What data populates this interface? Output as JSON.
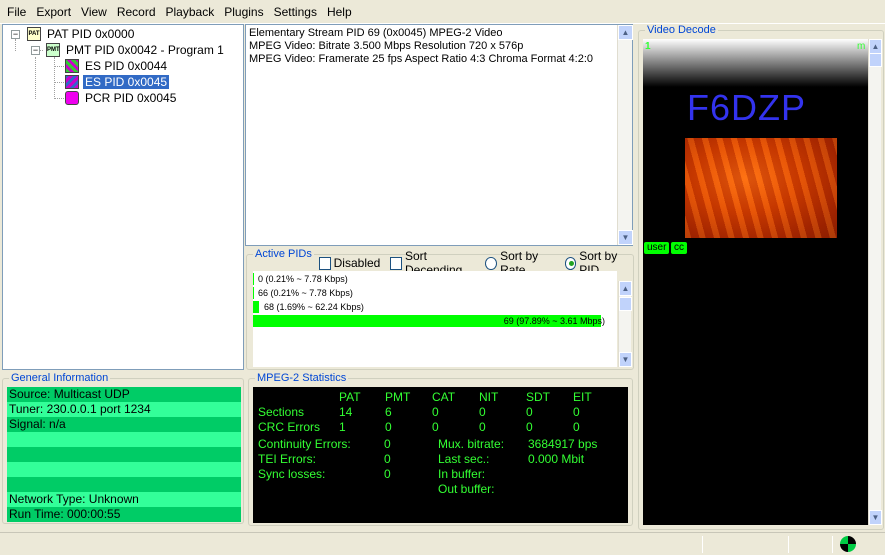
{
  "menu": [
    "File",
    "Export",
    "View",
    "Record",
    "Playback",
    "Plugins",
    "Settings",
    "Help"
  ],
  "tree": {
    "pat": "PAT PID 0x0000",
    "pmt": "PMT PID 0x0042 - Program 1",
    "es_audio": "ES PID 0x0044",
    "es_video": "ES PID 0x0045",
    "pcr": "PCR PID 0x0045"
  },
  "info_lines": [
    "Elementary Stream PID 69 (0x0045) MPEG-2 Video",
    "MPEG Video: Bitrate 3.500 Mbps Resolution 720 x 576p",
    "MPEG Video: Framerate 25 fps Aspect Ratio 4:3 Chroma Format 4:2:0"
  ],
  "active_pids": {
    "title": "Active PIDs",
    "disabled_label": "Disabled",
    "sort_desc_label": "Sort Decending",
    "sort_rate_label": "Sort by Rate",
    "sort_pid_label": "Sort by PID",
    "sort_selected": "Sort by PID",
    "rows": [
      {
        "label": "0 (0.21% ~ 7.78 Kbps)",
        "share": 0.21
      },
      {
        "label": "66 (0.21% ~ 7.78 Kbps)",
        "share": 0.21
      },
      {
        "label": "68 (1.69% ~ 62.24 Kbps)",
        "share": 1.69
      },
      {
        "label": "69 (97.89% ~ 3.61 Mbps)",
        "share": 97.89
      }
    ]
  },
  "general_info": {
    "title": "General Information",
    "rows": [
      "Source: Multicast UDP",
      "Tuner: 230.0.0.1 port 1234",
      "Signal: n/a",
      "",
      "",
      "",
      "",
      "Network Type: Unknown",
      "Run Time: 000:00:55"
    ]
  },
  "stats": {
    "title": "MPEG-2 Statistics",
    "headers": [
      "PAT",
      "PMT",
      "CAT",
      "NIT",
      "SDT",
      "EIT"
    ],
    "sections_label": "Sections",
    "sections": [
      "14",
      "6",
      "0",
      "0",
      "0",
      "0"
    ],
    "crc_label": "CRC Errors",
    "crc": [
      "1",
      "0",
      "0",
      "0",
      "0",
      "0"
    ],
    "continuity_label": "Continuity Errors:",
    "continuity": "0",
    "tei_label": "TEI Errors:",
    "tei": "0",
    "sync_label": "Sync losses:",
    "sync": "0",
    "mux_label": "Mux. bitrate:",
    "mux": "3684917 bps",
    "lastsec_label": "Last sec.:",
    "lastsec": "0.000 Mbit",
    "inbuf_label": "In buffer:",
    "outbuf_label": "Out buffer:"
  },
  "video": {
    "title": "Video Decode",
    "channel": "F6DZP",
    "tag_left": "1",
    "tag_right": "m",
    "btn_user": "user",
    "btn_cc": "cc"
  }
}
